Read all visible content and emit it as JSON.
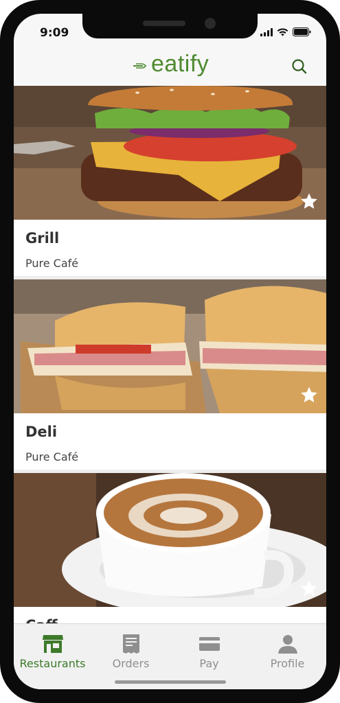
{
  "status_bar": {
    "time": "9:09",
    "signal_icon": "signal-icon",
    "wifi_icon": "wifi-icon",
    "battery_icon": "battery-icon"
  },
  "header": {
    "logo_text": "eatify",
    "logo_icon": "fork-logo-icon",
    "search_icon": "search-icon",
    "brand_color": "#4e8a2f"
  },
  "restaurants": [
    {
      "name": "Grill",
      "location": "Pure Café",
      "image": "burger-photo",
      "favorite_icon": "star-icon"
    },
    {
      "name": "Deli",
      "location": "Pure Café",
      "image": "sandwich-photo",
      "favorite_icon": "star-icon"
    },
    {
      "name": "Caff",
      "location": "",
      "image": "coffee-photo",
      "favorite_icon": "star-icon"
    }
  ],
  "tabs": [
    {
      "label": "Restaurants",
      "icon": "storefront-icon",
      "active": true
    },
    {
      "label": "Orders",
      "icon": "receipt-icon",
      "active": false
    },
    {
      "label": "Pay",
      "icon": "card-icon",
      "active": false
    },
    {
      "label": "Profile",
      "icon": "person-icon",
      "active": false
    }
  ],
  "colors": {
    "accent": "#4e8a2f",
    "tab_inactive": "#8f8f8f",
    "title_text": "#333333"
  }
}
